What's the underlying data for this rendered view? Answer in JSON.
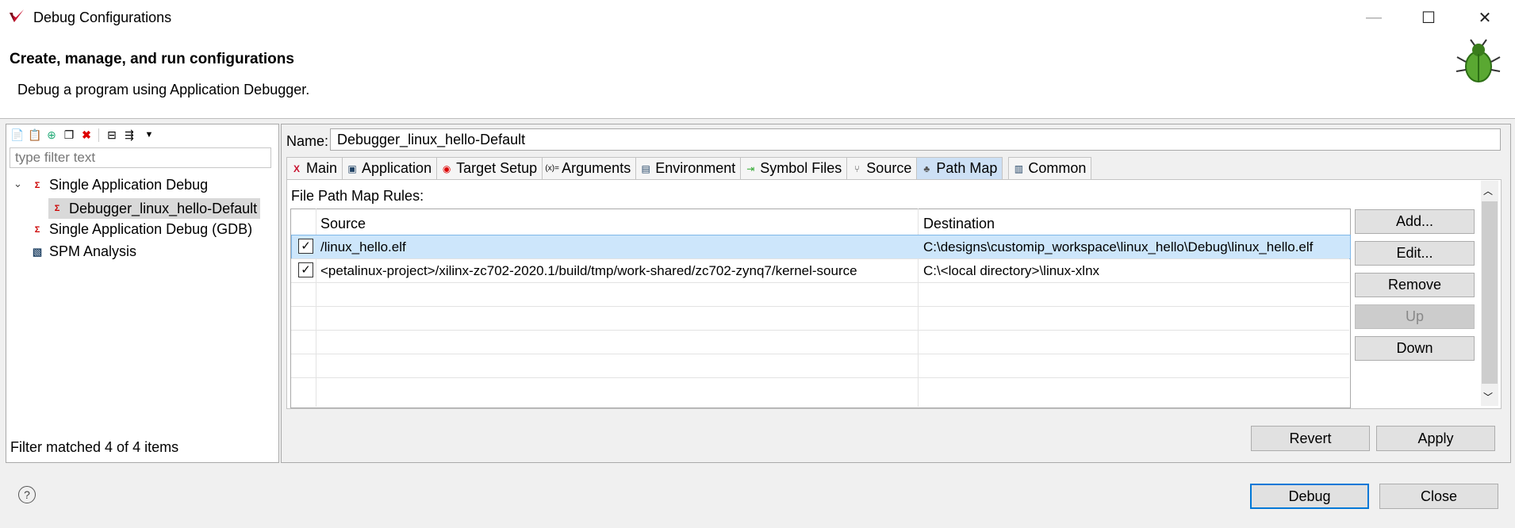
{
  "window": {
    "title": "Debug Configurations",
    "minimize": "—",
    "maximize": "☐",
    "close": "✕"
  },
  "header": {
    "title": "Create, manage, and run configurations",
    "description": "Debug a program using Application Debugger."
  },
  "left": {
    "filter_placeholder": "type filter text",
    "tree": [
      {
        "label": "Single Application Debug"
      },
      {
        "label": "Debugger_linux_hello-Default"
      },
      {
        "label": "Single Application Debug (GDB)"
      },
      {
        "label": "SPM Analysis"
      }
    ],
    "status": "Filter matched 4 of 4 items"
  },
  "config": {
    "name_label": "Name:",
    "name_value": "Debugger_linux_hello-Default",
    "tabs": [
      "Main",
      "Application",
      "Target Setup",
      "Arguments",
      "Environment",
      "Symbol Files",
      "Source",
      "Path Map",
      "Common"
    ],
    "active_tab": "Path Map",
    "section_label": "File Path Map Rules:",
    "table": {
      "columns": [
        "Source",
        "Destination"
      ],
      "rows": [
        {
          "checked": true,
          "source": "/linux_hello.elf",
          "destination": "C:\\designs\\customip_workspace\\linux_hello\\Debug\\linux_hello.elf"
        },
        {
          "checked": true,
          "source": "<petalinux-project>/xilinx-zc702-2020.1/build/tmp/work-shared/zc702-zynq7/kernel-source",
          "destination": "C:\\<local directory>\\linux-xlnx"
        }
      ]
    },
    "side_buttons": [
      "Add...",
      "Edit...",
      "Remove",
      "Up",
      "Down"
    ],
    "revert": "Revert",
    "apply": "Apply"
  },
  "footer": {
    "debug": "Debug",
    "close": "Close"
  },
  "colors": {
    "selection": "#cde6fb",
    "active_tab": "#cde0f5",
    "accent": "#0078d7"
  }
}
